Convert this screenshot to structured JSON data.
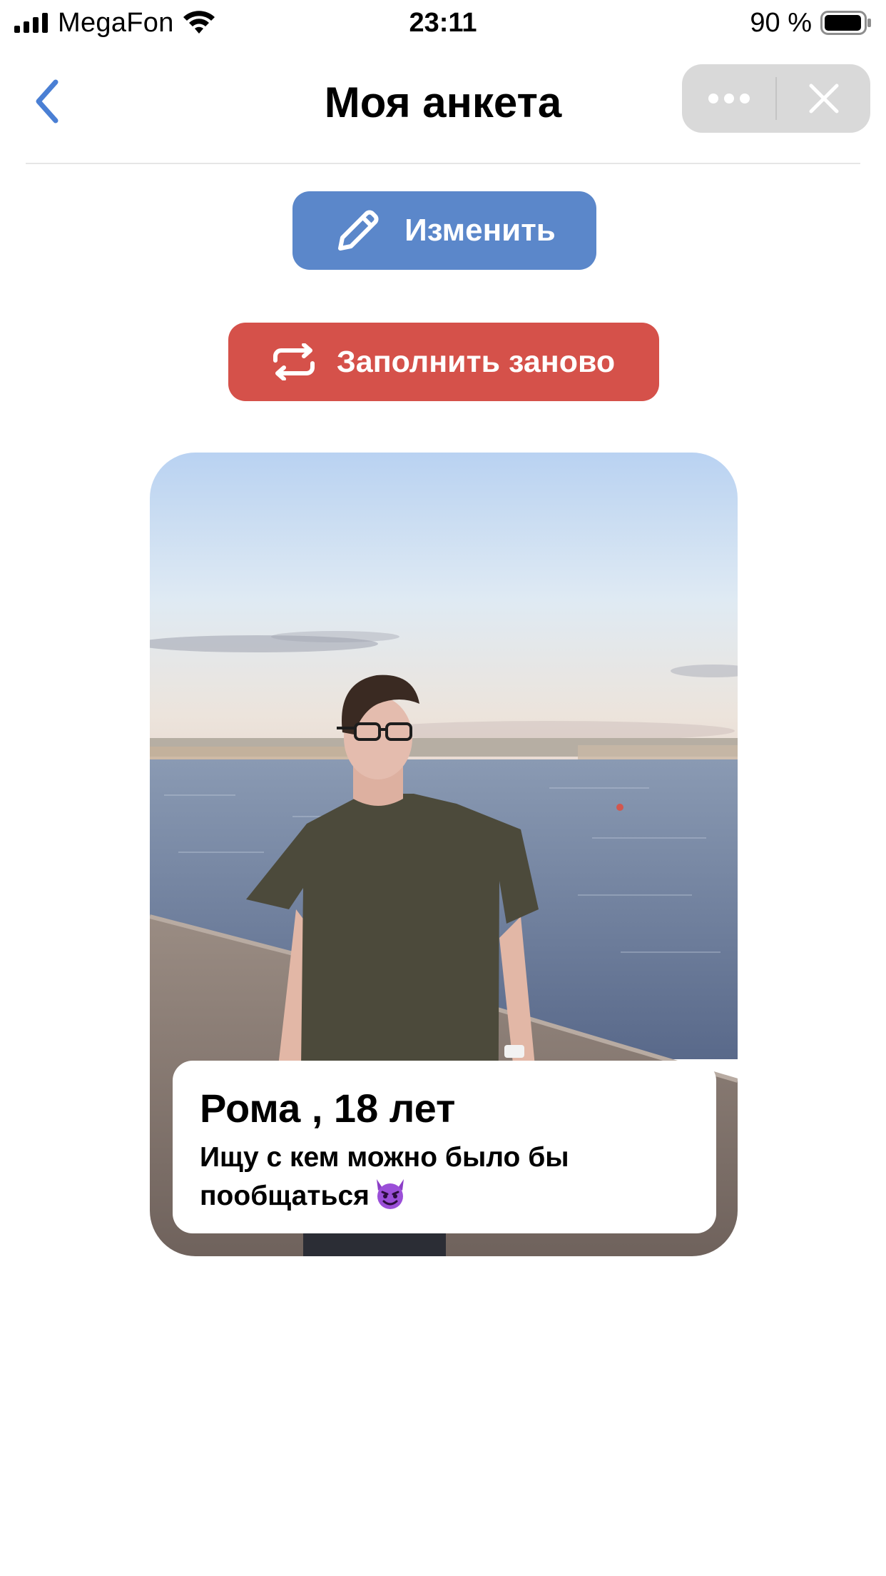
{
  "status_bar": {
    "carrier": "MegaFon",
    "time": "23:11",
    "battery_percent": "90 %",
    "signal_bars": 4,
    "signal_icon": "signal-bars-icon",
    "wifi_icon": "wifi-icon",
    "battery_icon": "battery-icon"
  },
  "nav": {
    "title": "Моя анкета",
    "back_icon": "chevron-left-icon",
    "more_icon": "more-dots-icon",
    "close_icon": "close-icon"
  },
  "actions": {
    "edit_label": "Изменить",
    "edit_icon": "pencil-icon",
    "edit_color": "#5b87ca",
    "refill_label": "Заполнить заново",
    "refill_icon": "repeat-icon",
    "refill_color": "#d5514a"
  },
  "profile": {
    "name_age": "Рома , 18 лет",
    "bio": "Ищу с кем можно было бы пообщаться",
    "bio_emoji": "smiling-devil-emoji-icon"
  }
}
